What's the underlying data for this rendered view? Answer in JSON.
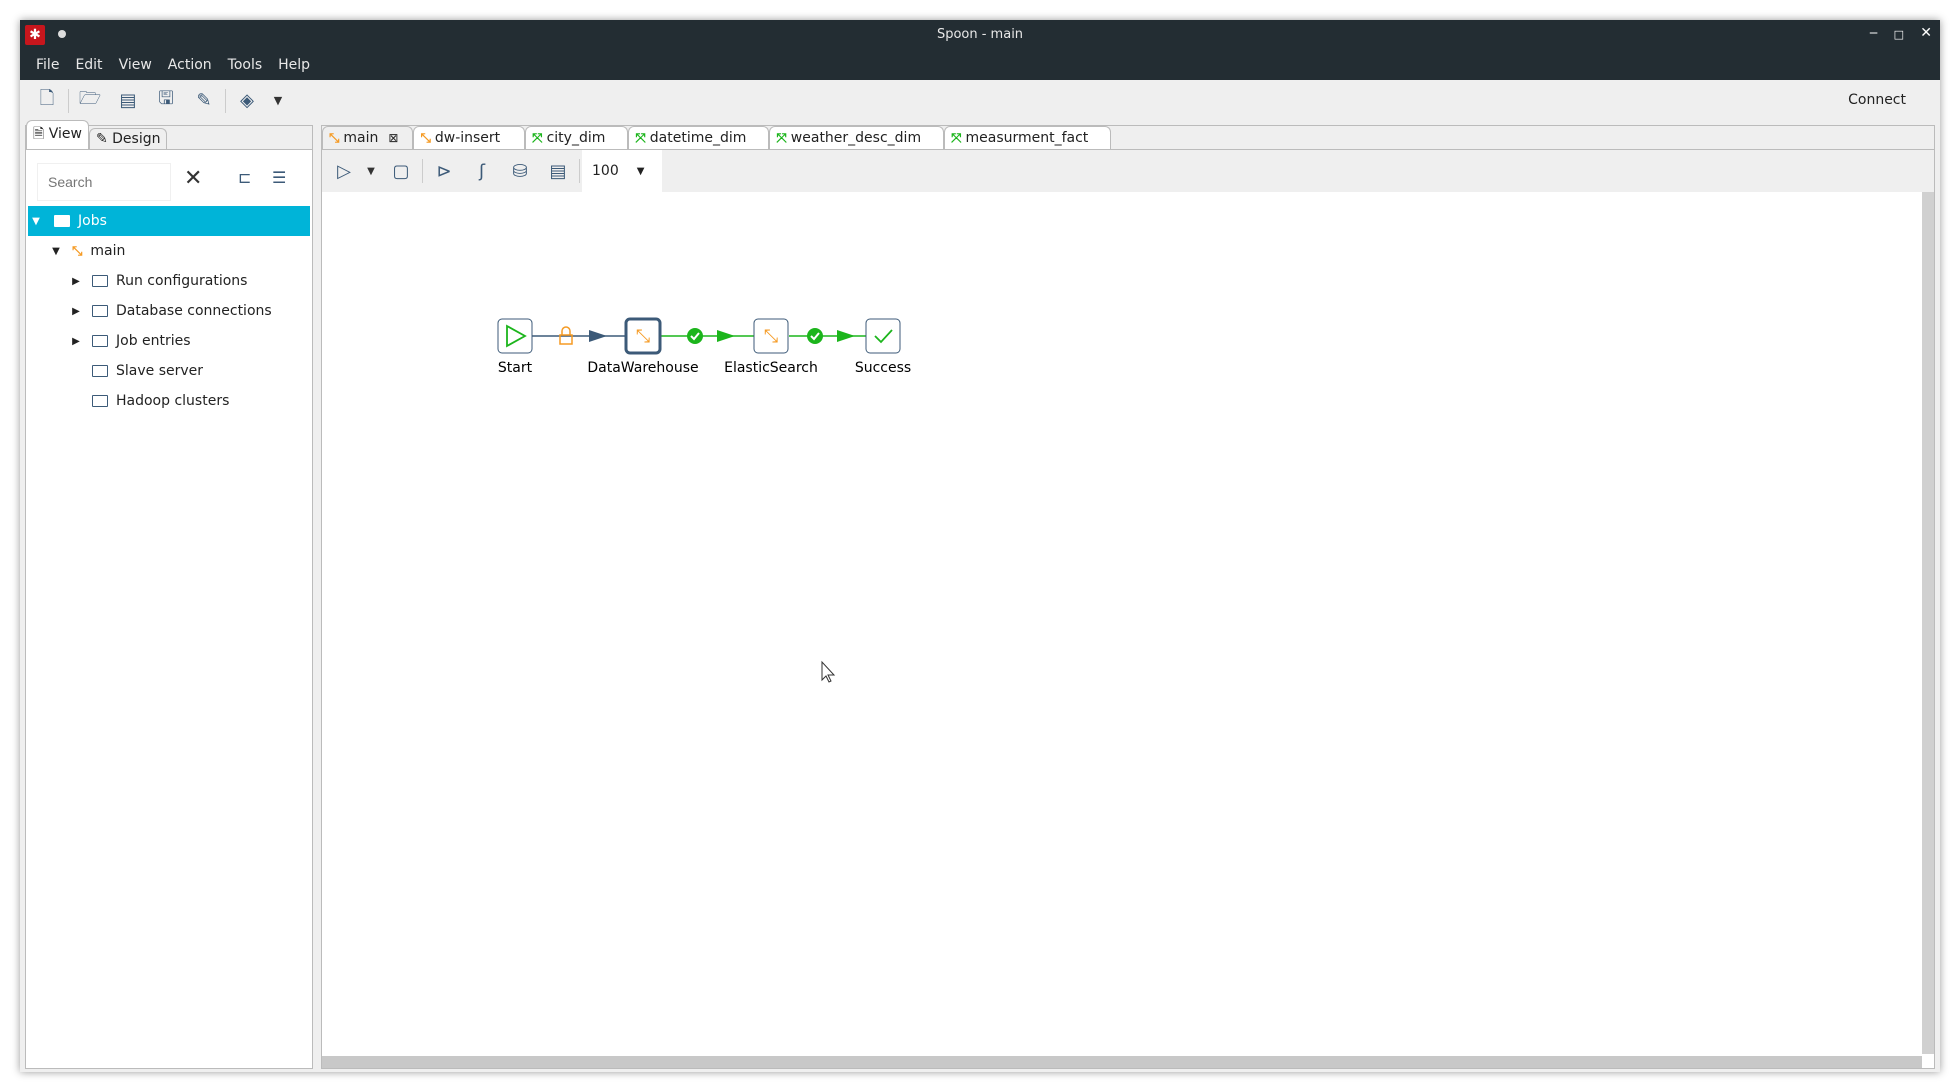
{
  "window": {
    "title": "Spoon - main",
    "minimize": "‒",
    "maximize": "□",
    "close": "✕"
  },
  "menu": [
    "File",
    "Edit",
    "View",
    "Action",
    "Tools",
    "Help"
  ],
  "toolbar": {
    "connect": "Connect"
  },
  "left_panel": {
    "tabs": [
      "View",
      "Design"
    ],
    "search_placeholder": "Search",
    "tree": [
      {
        "label": "Jobs",
        "level": 0,
        "expanded": true,
        "selected": true
      },
      {
        "label": "main",
        "level": 1,
        "expanded": true
      },
      {
        "label": "Run configurations",
        "level": 2,
        "collapsed": true
      },
      {
        "label": "Database connections",
        "level": 2,
        "collapsed": true
      },
      {
        "label": "Job entries",
        "level": 2,
        "collapsed": true
      },
      {
        "label": "Slave server",
        "level": 2
      },
      {
        "label": "Hadoop clusters",
        "level": 2
      }
    ]
  },
  "tabs": [
    {
      "label": "main",
      "type": "job",
      "active": true
    },
    {
      "label": "dw-insert",
      "type": "job"
    },
    {
      "label": "city_dim",
      "type": "transformation"
    },
    {
      "label": "datetime_dim",
      "type": "transformation"
    },
    {
      "label": "weather_desc_dim",
      "type": "transformation"
    },
    {
      "label": "measurment_fact",
      "type": "transformation"
    }
  ],
  "canvas_toolbar": {
    "zoom": "100"
  },
  "job": {
    "nodes": [
      {
        "label": "Start",
        "icon": "start-icon"
      },
      {
        "label": "DataWarehouse",
        "icon": "job-icon",
        "selected": true
      },
      {
        "label": "ElasticSearch",
        "icon": "job-icon"
      },
      {
        "label": "Success",
        "icon": "success-icon"
      }
    ],
    "hops": [
      {
        "from": "Start",
        "to": "DataWarehouse",
        "type": "unconditional",
        "icon": "lock-icon"
      },
      {
        "from": "DataWarehouse",
        "to": "ElasticSearch",
        "type": "success",
        "icon": "check-icon"
      },
      {
        "from": "ElasticSearch",
        "to": "Success",
        "type": "success",
        "icon": "check-icon"
      }
    ]
  },
  "colors": {
    "titlebar": "#232d33",
    "selection": "#00b4d8",
    "success": "#1cb51c",
    "job": "#f59a23",
    "node_border": "#3c5a78"
  }
}
